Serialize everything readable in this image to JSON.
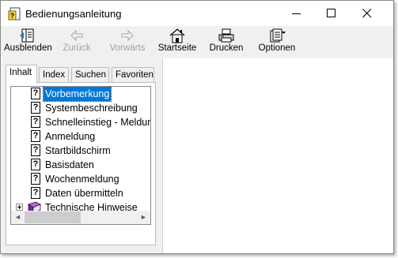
{
  "window": {
    "title": "Bedienungsanleitung"
  },
  "toolbar": {
    "hide": "Ausblenden",
    "back": "Zurück",
    "forward": "Vorwärts",
    "home": "Startseite",
    "print": "Drucken",
    "options": "Optionen"
  },
  "tabs": [
    "Inhalt",
    "Index",
    "Suchen",
    "Favoriten"
  ],
  "tree": {
    "items": [
      "Vorbemerkung",
      "Systembeschreibung",
      "Schnelleinstieg - Meldung",
      "Anmeldung",
      "Startbildschirm",
      "Basisdaten",
      "Wochenmeldung",
      "Daten übermitteln"
    ],
    "book": "Technische Hinweise",
    "selected": "Vorbemerkung",
    "page_icon_glyph": "?",
    "hscroll_left": "◄",
    "hscroll_right": "►"
  },
  "colors": {
    "selection": "#0078d7",
    "book": "#7a2a8c"
  }
}
